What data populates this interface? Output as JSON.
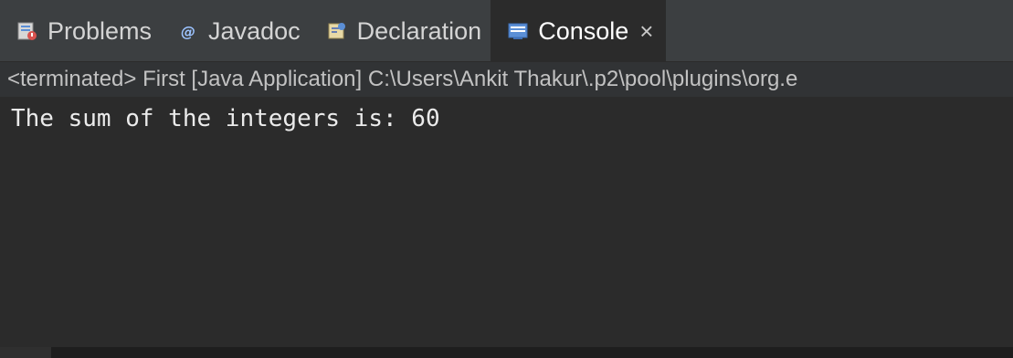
{
  "tabs": [
    {
      "label": "Problems",
      "icon": "problems-icon",
      "active": false
    },
    {
      "label": "Javadoc",
      "icon": "javadoc-icon",
      "active": false
    },
    {
      "label": "Declaration",
      "icon": "declaration-icon",
      "active": false
    },
    {
      "label": "Console",
      "icon": "console-icon",
      "active": true,
      "close": "×"
    }
  ],
  "console": {
    "process_label": "<terminated> First [Java Application] C:\\Users\\Ankit Thakur\\.p2\\pool\\plugins\\org.e",
    "output_lines": [
      "The sum of the integers is: 60"
    ]
  },
  "colors": {
    "tab_bar_bg": "#3c3f41",
    "console_bg": "#2b2b2b",
    "console_text": "#ebebeb",
    "console_icon_blue": "#5b8fd6",
    "javadoc_icon": "#9cc3ff",
    "problems_icon_red": "#d9534f"
  }
}
